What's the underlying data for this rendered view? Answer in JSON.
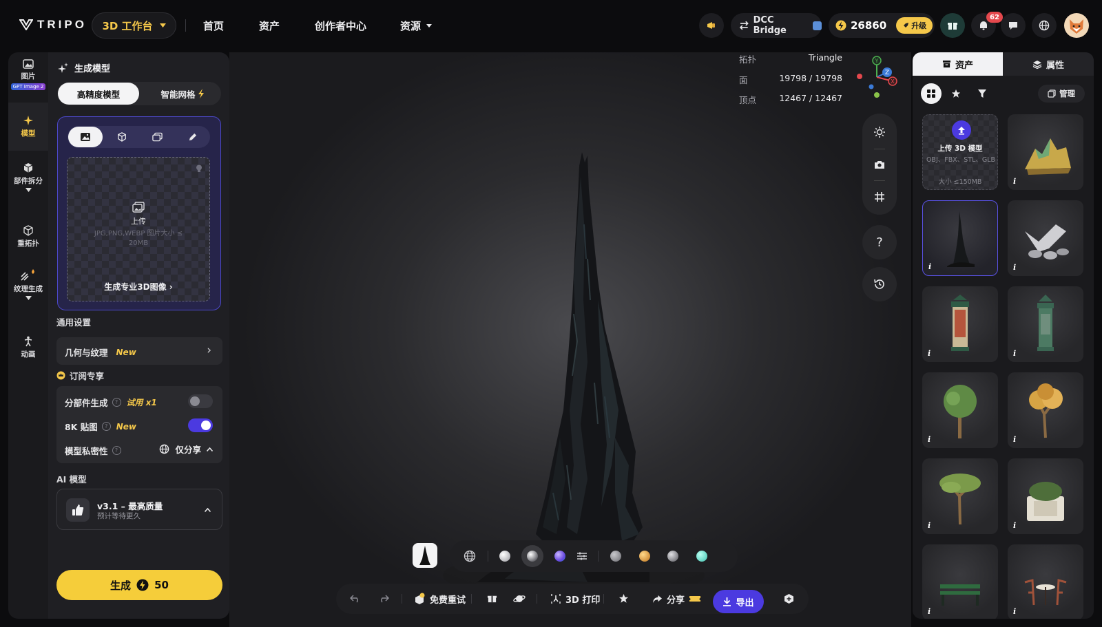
{
  "brand": {
    "name": "TRIPO"
  },
  "topbar": {
    "workspace_label": "3D 工作台",
    "nav": [
      "首页",
      "资产",
      "创作者中心",
      "资源"
    ],
    "dcc_label": "DCC Bridge",
    "credits": "26860",
    "upgrade_label": "升级",
    "notification_count": "62"
  },
  "rail": {
    "items": [
      {
        "label": "图片",
        "tag": "GPT Image 2"
      },
      {
        "label": "模型"
      },
      {
        "label": "部件拆分"
      },
      {
        "label": "重拓扑"
      },
      {
        "label": "纹理生成"
      },
      {
        "label": "动画"
      }
    ]
  },
  "panel": {
    "title": "生成模型",
    "mode_tabs": [
      "高精度模型",
      "智能网格"
    ],
    "upload": {
      "label": "上传",
      "hint": "JPG,PNG,WEBP 图片大小 ≤ 20MB",
      "pro_link": "生成专业3D图像"
    },
    "general_settings": "通用设置",
    "geometry_row": {
      "label": "几何与纹理",
      "tag": "New"
    },
    "subscription_title": "订阅专享",
    "options": [
      {
        "label": "分部件生成",
        "tag": "试用 x1",
        "enabled": false
      },
      {
        "label": "8K 贴图",
        "tag": "New",
        "enabled": true
      }
    ],
    "privacy": {
      "label": "模型私密性",
      "value": "仅分享"
    },
    "ai_model_title": "AI 模型",
    "ai_model": {
      "name": "v3.1 – 最高质量",
      "sub": "预计等待更久"
    },
    "generate": {
      "label": "生成",
      "cost": "50"
    }
  },
  "viewport": {
    "stats": [
      {
        "key": "拓扑",
        "value": "Triangle"
      },
      {
        "key": "面",
        "value": "19798 / 19798"
      },
      {
        "key": "顶点",
        "value": "12467 / 12467"
      }
    ],
    "axis_labels": {
      "y": "Y",
      "z": "Z",
      "x": "X"
    },
    "help_label": "?",
    "actions": {
      "retry": "免费重试",
      "print": "3D 打印",
      "share": "分享",
      "export": "导出"
    }
  },
  "rightpanel": {
    "tabs": [
      "资产",
      "属性"
    ],
    "manage": "管理",
    "upload_tile": {
      "title": "上传 3D 模型",
      "formats": "OBJ、FBX、STL、GLB",
      "size": "大小 ≤150MB"
    },
    "info_glyph": "i"
  },
  "colors": {
    "accent": "#4b3ae0",
    "generate": "#f5cd3a",
    "new_tag": "#f5c84a",
    "selection": "#5a52e6"
  }
}
